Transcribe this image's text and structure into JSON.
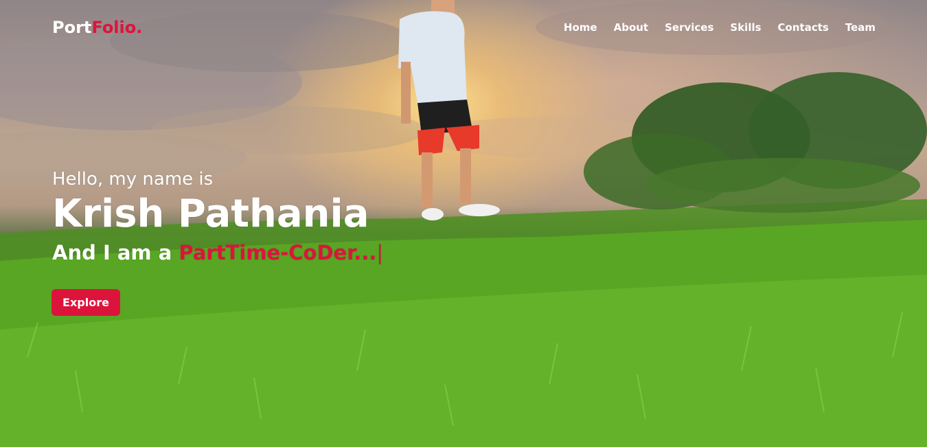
{
  "navbar": {
    "logo_main": "Port",
    "logo_accent": "Folio.",
    "items": [
      {
        "label": "Home"
      },
      {
        "label": "About"
      },
      {
        "label": "Services"
      },
      {
        "label": "Skills"
      },
      {
        "label": "Contacts"
      },
      {
        "label": "Team"
      }
    ]
  },
  "hero": {
    "greeting": "Hello, my name is",
    "name": "Krish Pathania",
    "role_prefix": "And I am a ",
    "role_typed": "PartTime-CoDer...",
    "cursor": "|",
    "button_label": "Explore"
  },
  "colors": {
    "accent": "#dc143c",
    "text": "#ffffff"
  }
}
